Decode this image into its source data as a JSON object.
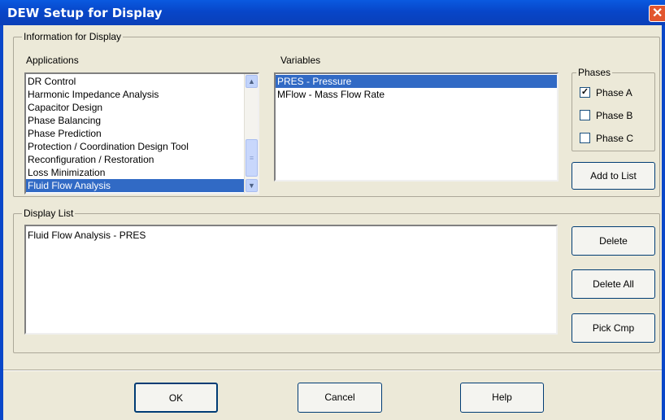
{
  "window": {
    "title": "DEW Setup for Display",
    "close_symbol": "✕"
  },
  "info_group": {
    "legend": "Information for Display",
    "applications_label": "Applications",
    "applications": [
      "DR Control",
      "Harmonic Impedance Analysis",
      "Capacitor Design",
      "Phase Balancing",
      "Phase Prediction",
      "Protection / Coordination Design Tool",
      "Reconfiguration / Restoration",
      "Loss Minimization",
      "Fluid Flow Analysis"
    ],
    "selected_application": "Fluid Flow Analysis",
    "variables_label": "Variables",
    "variables": [
      "PRES - Pressure",
      "MFlow - Mass Flow Rate"
    ],
    "selected_variable": "PRES - Pressure",
    "phases": {
      "legend": "Phases",
      "items": [
        {
          "label": "Phase A",
          "checked": true
        },
        {
          "label": "Phase B",
          "checked": false
        },
        {
          "label": "Phase C",
          "checked": false
        }
      ]
    },
    "add_to_list_label": "Add to List"
  },
  "display_group": {
    "legend": "Display List",
    "items": [
      "Fluid Flow Analysis - PRES"
    ],
    "delete_label": "Delete",
    "delete_all_label": "Delete All",
    "pick_cmp_label": "Pick Cmp"
  },
  "footer": {
    "ok_label": "OK",
    "cancel_label": "Cancel",
    "help_label": "Help"
  },
  "colors": {
    "title_bar": "#0a4fd6",
    "selection": "#316ac5",
    "dialog_bg": "#ece9d8",
    "close_button": "#e2562f"
  }
}
